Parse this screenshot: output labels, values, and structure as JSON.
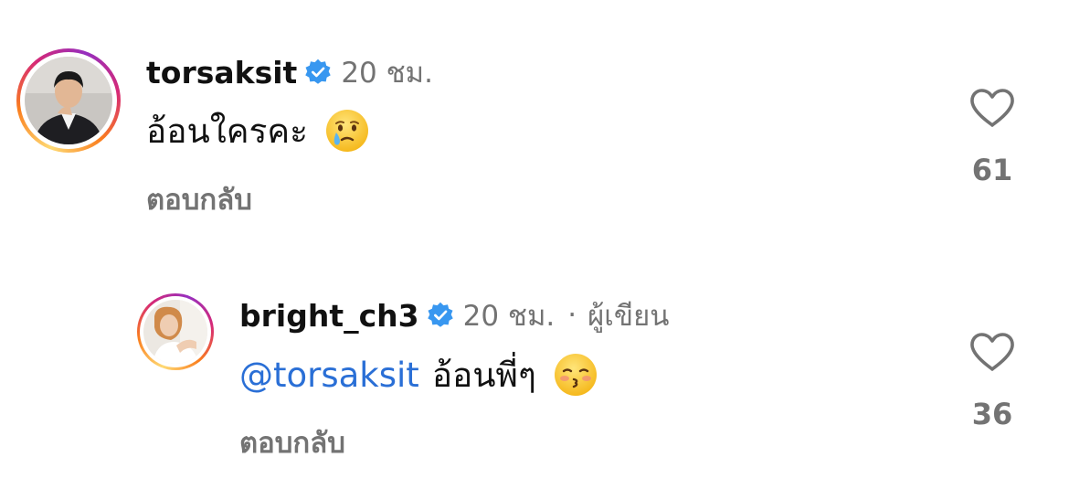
{
  "comments": [
    {
      "username": "torsaksit",
      "verified": true,
      "time": "20 ชม.",
      "text": "อ้อนใครคะ",
      "emoji": "crying-face-emoji",
      "reply_label": "ตอบกลับ",
      "likes": "61"
    },
    {
      "username": "bright_ch3",
      "verified": true,
      "time": "20 ชม.",
      "separator": "·",
      "author_label": "ผู้เขียน",
      "mention": "@torsaksit",
      "text": "อ้อนพี่ๆ",
      "emoji": "kissing-face-emoji",
      "reply_label": "ตอบกลับ",
      "likes": "36"
    }
  ],
  "colors": {
    "verified_badge": "#3897f0",
    "mention": "#2a6fd6",
    "secondary_text": "#737373"
  }
}
